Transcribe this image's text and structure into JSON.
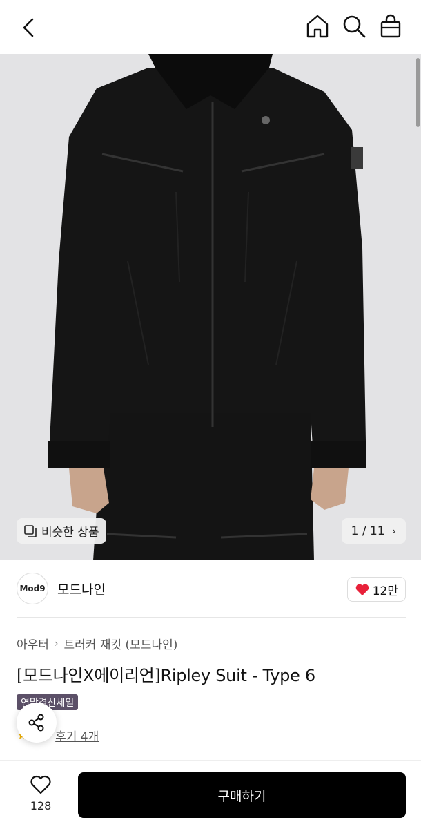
{
  "header": {
    "back_icon": "chevron-left-icon",
    "home_icon": "home-icon",
    "search_icon": "search-icon",
    "cart_icon": "shopping-bag-icon"
  },
  "gallery": {
    "similar_label": "비슷한 상품",
    "counter": "1 / 11"
  },
  "brand": {
    "logo_text": "Mod9",
    "name": "모드나인",
    "likes": "12만",
    "like_color": "#e8213a"
  },
  "breadcrumb": {
    "items": [
      "아우터",
      "트러커 재킷 (모드나인)"
    ]
  },
  "product": {
    "title": "[모드나인X에이리언]Ripley Suit - Type 6",
    "badge": "연말결산세일",
    "badge_color": "#5c5068",
    "review_link": "후기 4개"
  },
  "bottom": {
    "wish_count": "128",
    "buy_label": "구매하기"
  }
}
